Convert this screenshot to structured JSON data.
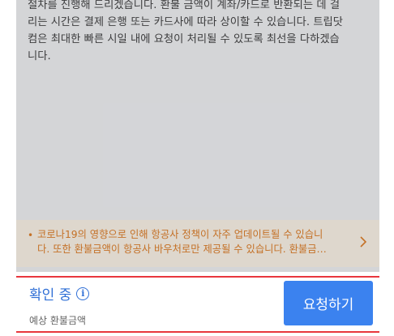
{
  "content": {
    "body_lines": [
      "절차를 진행해 드리겠습니다. 환불 금액이 계좌/카드로 반환되는 데 걸",
      "리는 시간은 결제 은행 또는 카드사에 따라 상이할 수 있습니다. 트립닷",
      "컴은 최대한 빠른 시일 내에 요청이 처리될 수 있도록 최선을 다하겠습",
      "니다."
    ],
    "notice": {
      "line1": "코로나19의 영향으로 인해 항공사 정책이 자주 업데이트될 수 있습니",
      "line2": "다. 또한 환불금액이 항공사 바우처로만 제공될 수 있습니다. 환불금…",
      "icon": "chevron-right-icon"
    }
  },
  "footer": {
    "status": "확인 중",
    "status_icon": "info-icon",
    "sub_label": "예상 환불금액",
    "button_label": "요청하기"
  },
  "colors": {
    "accent": "#3b82ef",
    "status_text": "#2f6fd6",
    "notice_text": "#e07a1f",
    "highlight_border": "#e8373d"
  }
}
